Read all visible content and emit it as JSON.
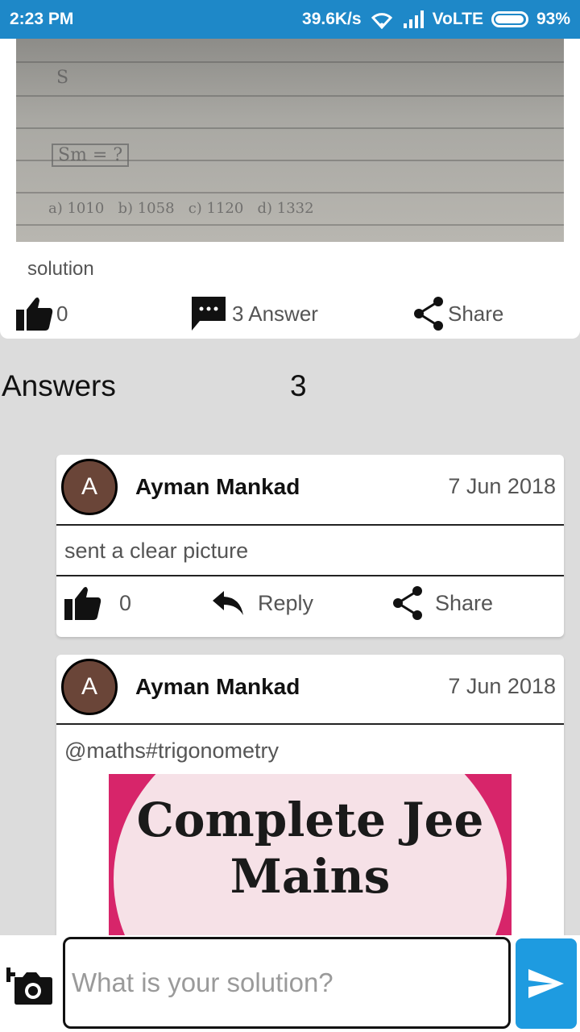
{
  "status_bar": {
    "time": "2:23 PM",
    "net_speed": "39.6K/s",
    "network": "VoLTE",
    "battery": "93%"
  },
  "question": {
    "image_text": {
      "line1": "S",
      "line2": "Sm = ?",
      "options": "a) 1010   b) 1058   c) 1120   d) 1332"
    },
    "description": "solution",
    "like_count": "0",
    "answer_label": "3 Answer",
    "share_label": "Share"
  },
  "answers_header": {
    "title": "Answers",
    "count": "3"
  },
  "answers": [
    {
      "avatar_letter": "A",
      "author": "Ayman Mankad",
      "date": "7 Jun 2018",
      "text": "sent a clear picture",
      "like_count": "0",
      "reply_label": "Reply",
      "share_label": "Share"
    },
    {
      "avatar_letter": "A",
      "author": "Ayman Mankad",
      "date": "7 Jun 2018",
      "text": "@maths#trigonometry",
      "image_line1": "Complete Jee",
      "image_line2": "Mains"
    }
  ],
  "input_bar": {
    "placeholder": "What is your solution?"
  },
  "colors": {
    "primary": "#1e88c8",
    "send": "#1e9be0",
    "avatar": "#6a4538",
    "background": "#dcdcdc"
  },
  "icons": [
    "wifi-icon",
    "signal-icon",
    "battery-icon",
    "thumbs-up-icon",
    "chat-icon",
    "share-icon",
    "reply-icon",
    "add-photo-icon",
    "send-icon"
  ]
}
